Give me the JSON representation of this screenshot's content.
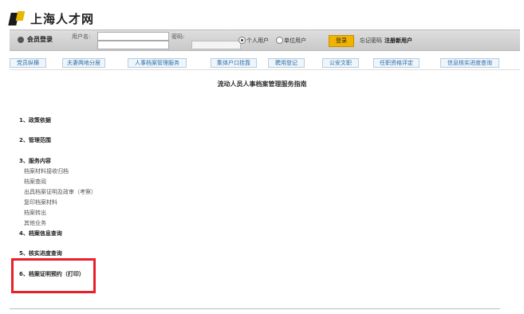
{
  "brand": {
    "name": "上海人才网"
  },
  "login": {
    "title": "会员登录",
    "username_label": "用户名:",
    "password_label": "密码:",
    "radio_personal": "个人用户",
    "radio_company": "单位用户",
    "login_button": "登录",
    "forgot": "忘记密码",
    "register": "注册新用户"
  },
  "nav": [
    "党员纵横",
    "夫妻两地分居",
    "人事档案管理服务",
    "集体户口挂靠",
    "聘用登记",
    "公安文职",
    "任职资格评定",
    "信息核实进度查询"
  ],
  "page": {
    "title": "流动人员人事档案管理服务指南",
    "sections": [
      {
        "label": "1、政策依据"
      },
      {
        "label": "2、管理范围"
      },
      {
        "label": "3、服务内容",
        "items": [
          "档案材料接收归档",
          "档案查阅",
          "出具档案证明及政审（考察）",
          "复印档案材料",
          "档案转出",
          "其他业务"
        ]
      },
      {
        "label": "4、档案信息查询"
      },
      {
        "label": "5、核实进度查询"
      },
      {
        "label": "6、档案证明预约（打印）"
      }
    ]
  },
  "colors": {
    "highlight": "#e8202a",
    "login_button": "#f0b400",
    "nav_text": "#2e6da4"
  }
}
